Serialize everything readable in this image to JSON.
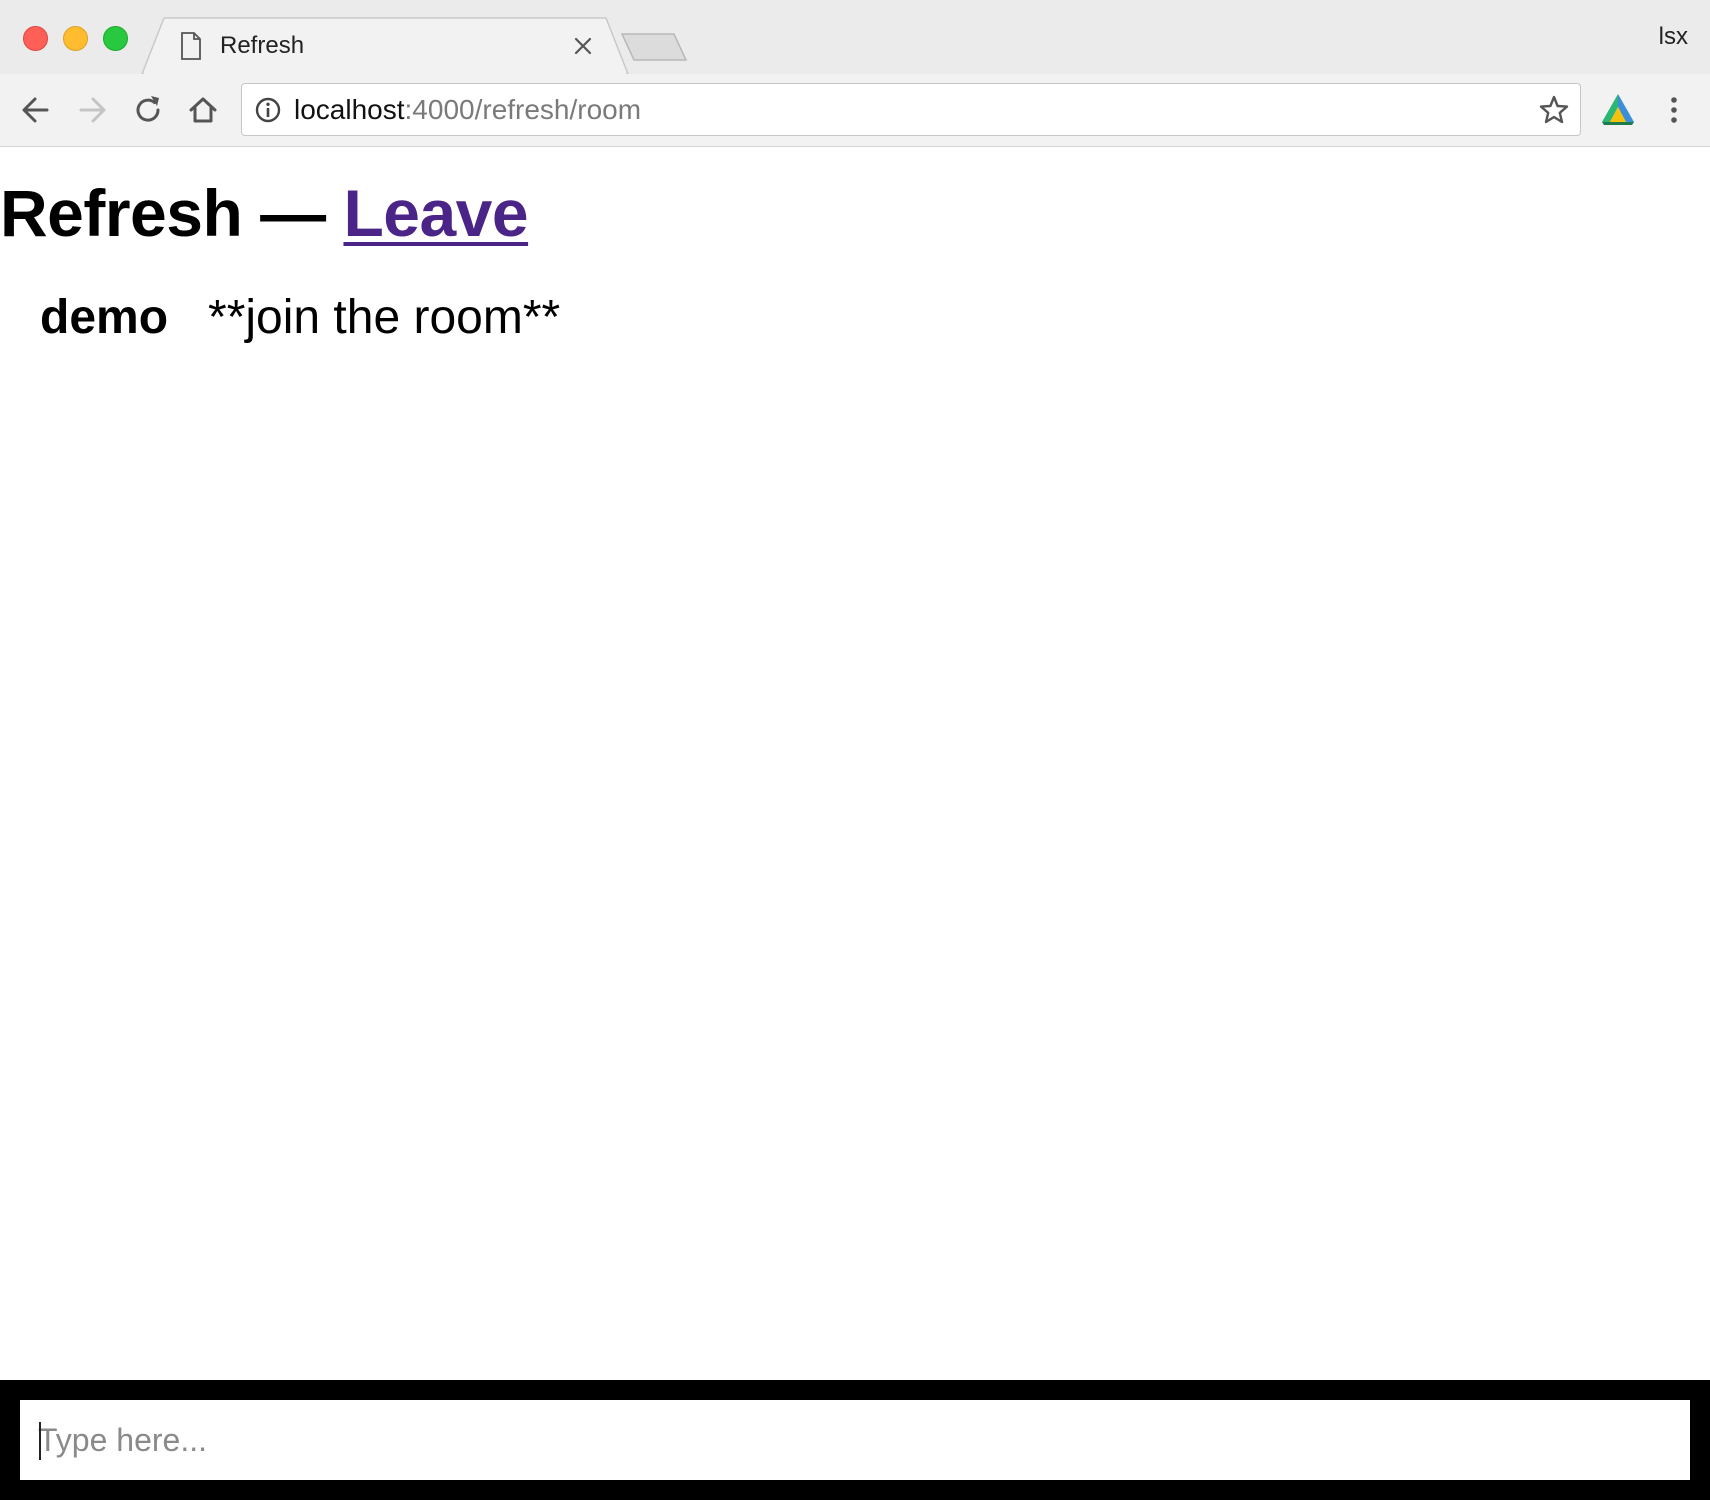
{
  "browser": {
    "tab": {
      "title": "Refresh"
    },
    "profile_name": "lsx",
    "address": {
      "host": "localhost",
      "rest": ":4000/refresh/room"
    }
  },
  "page": {
    "title": "Refresh",
    "separator": "—",
    "leave_link": "Leave",
    "messages": [
      {
        "user": "demo",
        "text": "**join the room**"
      }
    ],
    "composer": {
      "placeholder": "Type here...",
      "value": ""
    }
  },
  "colors": {
    "link": "#4b2488",
    "composer_border": "#000000",
    "tabstrip": "#ebebeb"
  }
}
